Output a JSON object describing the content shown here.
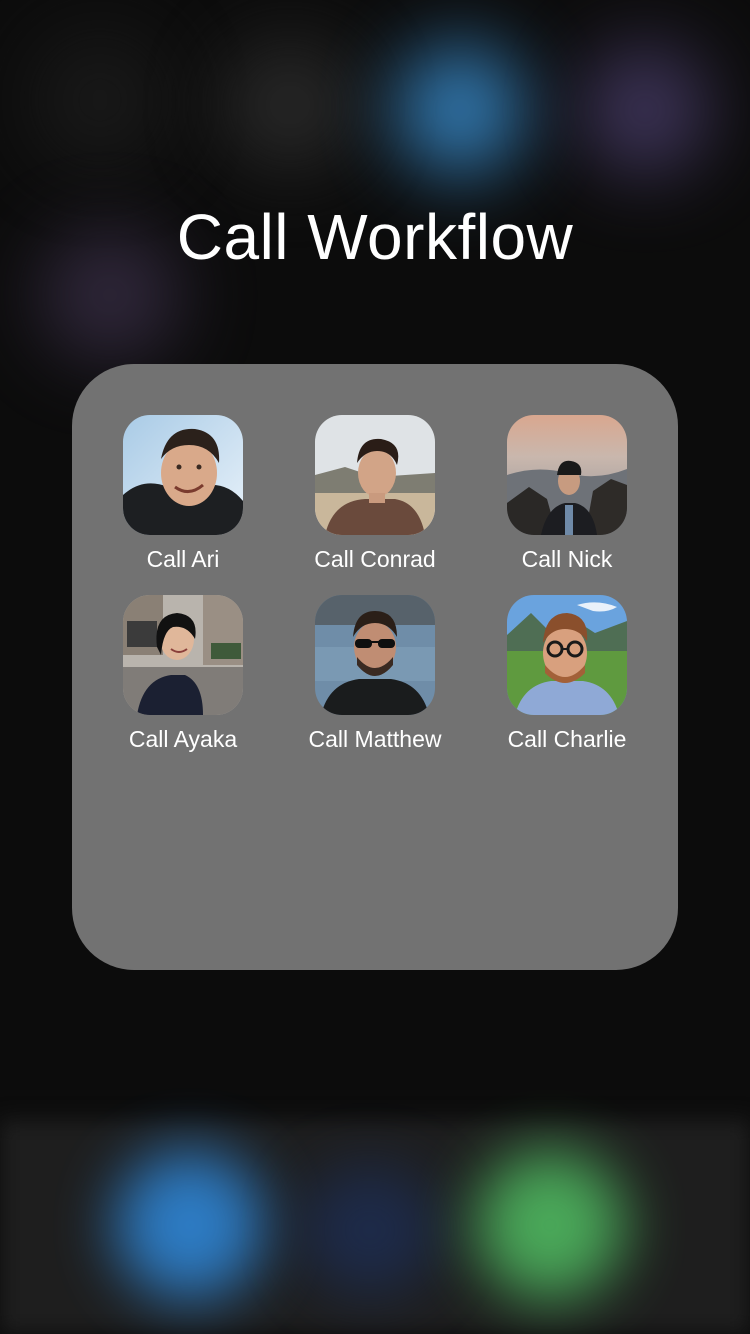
{
  "folder": {
    "title": "Call Workflow",
    "apps": [
      {
        "label": "Call Ari",
        "icon": "contact-photo-ari"
      },
      {
        "label": "Call Conrad",
        "icon": "contact-photo-conrad"
      },
      {
        "label": "Call Nick",
        "icon": "contact-photo-nick"
      },
      {
        "label": "Call Ayaka",
        "icon": "contact-photo-ayaka"
      },
      {
        "label": "Call Matthew",
        "icon": "contact-photo-matthew"
      },
      {
        "label": "Call Charlie",
        "icon": "contact-photo-charlie"
      }
    ]
  },
  "colors": {
    "folder_background": "#727272",
    "label_text": "#ffffff",
    "dock_blue": "#2f86d6",
    "dock_green": "#4fb860"
  }
}
